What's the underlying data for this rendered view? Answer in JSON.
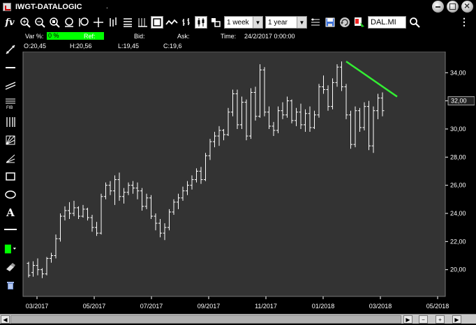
{
  "window": {
    "title": "IWGT-DATALOGIC",
    "dot": "."
  },
  "toolbar": {
    "logo": "fv",
    "period": "1 week",
    "range": "1 year",
    "symbol": "DAL.MI",
    "menu": "⋮",
    "icons": [
      "zoom-in-icon",
      "zoom-out-icon",
      "zoom-fit-icon",
      "zoom-x-icon",
      "zoom-y-icon",
      "crosshair-icon",
      "bars-icon",
      "list-icon",
      "grid-icon",
      "box-icon",
      "line-icon",
      "candle-icon",
      "compare-icon",
      "scale-icon",
      "save-icon",
      "refresh-icon",
      "color-icon",
      "search-icon"
    ]
  },
  "info": {
    "var_label": "Var %:",
    "var_value": "0 %",
    "ref_label": "Ref:",
    "bid_label": "Bid:",
    "ask_label": "Ask:",
    "time_label": "Time:",
    "time_value": "24/2/2017 0:00:00",
    "open": "O:20,45",
    "high": "H:20,56",
    "low": "L:19,45",
    "close": "C:19,6"
  },
  "left_tools": [
    "line-tool-icon",
    "hline-tool-icon",
    "channel-tool-icon",
    "fib-tool-icon",
    "cycle-tool-icon",
    "gann-tool-icon",
    "fan-tool-icon",
    "rect-tool-icon",
    "ellipse-tool-icon",
    "text-tool-icon",
    "divider-icon",
    "color-tool-icon",
    "eraser-icon",
    "trash-icon"
  ],
  "colors": {
    "plot_bg": "#333333",
    "price_bar": "#ffffff",
    "trendline": "#33ee33",
    "var_box": "#00ff00"
  },
  "chart_data": {
    "type": "ohlc",
    "x_tick_labels": [
      "03/2017",
      "05/2017",
      "07/2017",
      "09/2017",
      "11/2017",
      "01/2018",
      "03/2018",
      "05/2018"
    ],
    "y_ticks": [
      20,
      22,
      24,
      26,
      28,
      30,
      32,
      34
    ],
    "y_tick_labels": [
      "20,00",
      "22,00",
      "24,00",
      "26,00",
      "28,00",
      "30,00",
      "32,00",
      "34,00"
    ],
    "last_price_label": "32,00",
    "ylim": [
      18.1,
      35.5
    ],
    "bars": [
      [
        20.45,
        20.56,
        19.45,
        19.6
      ],
      [
        19.8,
        20.6,
        19.5,
        20.3
      ],
      [
        20.3,
        20.8,
        19.6,
        20.0
      ],
      [
        20.0,
        20.1,
        19.4,
        19.7
      ],
      [
        19.7,
        20.9,
        19.6,
        20.8
      ],
      [
        20.8,
        21.2,
        20.5,
        21.0
      ],
      [
        21.0,
        22.5,
        20.8,
        22.2
      ],
      [
        22.2,
        24.0,
        22.0,
        23.8
      ],
      [
        23.8,
        24.5,
        23.5,
        24.2
      ],
      [
        24.2,
        24.8,
        23.6,
        24.0
      ],
      [
        24.0,
        24.9,
        23.8,
        24.4
      ],
      [
        24.4,
        24.5,
        23.6,
        23.8
      ],
      [
        23.8,
        24.6,
        23.7,
        24.3
      ],
      [
        24.3,
        24.4,
        23.5,
        23.7
      ],
      [
        23.7,
        23.9,
        22.7,
        23.0
      ],
      [
        23.0,
        23.4,
        22.4,
        22.6
      ],
      [
        22.6,
        25.4,
        22.5,
        25.2
      ],
      [
        25.2,
        26.2,
        25.0,
        26.0
      ],
      [
        26.0,
        26.3,
        25.3,
        25.6
      ],
      [
        25.6,
        26.7,
        24.6,
        26.4
      ],
      [
        26.4,
        26.9,
        24.9,
        25.2
      ],
      [
        25.2,
        25.8,
        24.7,
        25.5
      ],
      [
        25.5,
        26.2,
        25.3,
        26.0
      ],
      [
        26.0,
        26.3,
        25.4,
        25.8
      ],
      [
        25.8,
        26.2,
        25.0,
        25.6
      ],
      [
        25.6,
        25.8,
        24.2,
        24.5
      ],
      [
        24.5,
        25.4,
        24.3,
        25.1
      ],
      [
        25.1,
        25.3,
        23.6,
        23.8
      ],
      [
        23.8,
        24.0,
        22.8,
        23.3
      ],
      [
        23.3,
        23.6,
        22.3,
        22.6
      ],
      [
        22.6,
        23.3,
        22.1,
        23.0
      ],
      [
        23.0,
        24.3,
        22.8,
        24.1
      ],
      [
        24.1,
        25.0,
        23.9,
        24.8
      ],
      [
        24.8,
        25.4,
        24.3,
        25.1
      ],
      [
        25.1,
        25.9,
        24.9,
        25.6
      ],
      [
        25.6,
        26.3,
        25.3,
        26.0
      ],
      [
        26.0,
        26.7,
        25.7,
        26.4
      ],
      [
        26.4,
        27.2,
        26.2,
        27.0
      ],
      [
        27.0,
        27.3,
        26.1,
        26.4
      ],
      [
        26.4,
        28.3,
        26.3,
        28.1
      ],
      [
        28.1,
        29.3,
        27.8,
        29.1
      ],
      [
        29.1,
        29.8,
        28.7,
        29.5
      ],
      [
        29.5,
        30.2,
        28.8,
        29.9
      ],
      [
        29.9,
        30.0,
        29.2,
        29.6
      ],
      [
        29.6,
        31.5,
        29.5,
        31.2
      ],
      [
        31.2,
        32.8,
        30.9,
        32.5
      ],
      [
        32.5,
        32.8,
        30.0,
        30.3
      ],
      [
        30.3,
        32.3,
        30.0,
        31.9
      ],
      [
        31.9,
        32.1,
        29.2,
        29.5
      ],
      [
        29.5,
        32.9,
        29.3,
        32.6
      ],
      [
        32.6,
        33.0,
        30.6,
        30.9
      ],
      [
        30.9,
        34.6,
        30.8,
        34.2
      ],
      [
        34.2,
        34.4,
        30.9,
        31.2
      ],
      [
        31.2,
        31.6,
        30.0,
        30.2
      ],
      [
        30.2,
        30.5,
        29.5,
        29.9
      ],
      [
        29.9,
        31.6,
        29.7,
        31.3
      ],
      [
        31.3,
        31.9,
        30.7,
        31.0
      ],
      [
        31.0,
        32.3,
        30.8,
        32.0
      ],
      [
        32.0,
        32.1,
        30.4,
        30.6
      ],
      [
        30.6,
        31.5,
        30.2,
        31.2
      ],
      [
        31.2,
        31.8,
        30.0,
        30.3
      ],
      [
        30.3,
        31.4,
        29.8,
        31.1
      ],
      [
        31.1,
        31.6,
        29.8,
        30.1
      ],
      [
        30.1,
        31.3,
        30.0,
        31.0
      ],
      [
        31.0,
        33.2,
        30.8,
        33.0
      ],
      [
        33.0,
        33.8,
        32.5,
        32.8
      ],
      [
        32.8,
        33.1,
        31.3,
        31.6
      ],
      [
        31.6,
        33.6,
        31.4,
        33.3
      ],
      [
        33.3,
        34.6,
        33.0,
        34.4
      ],
      [
        34.4,
        34.8,
        32.7,
        33.0
      ],
      [
        33.0,
        33.2,
        30.7,
        31.0
      ],
      [
        31.0,
        31.3,
        28.6,
        28.9
      ],
      [
        28.9,
        31.6,
        28.7,
        31.3
      ],
      [
        31.3,
        31.5,
        29.8,
        30.1
      ],
      [
        30.1,
        31.9,
        29.9,
        31.6
      ],
      [
        31.6,
        32.0,
        28.5,
        28.8
      ],
      [
        28.8,
        31.6,
        28.3,
        31.3
      ],
      [
        31.3,
        32.5,
        30.7,
        32.2
      ],
      [
        32.2,
        32.6,
        30.9,
        31.3
      ]
    ],
    "trendline": {
      "from_bar": 70,
      "from_price": 34.8,
      "to_bar": 80,
      "to_price": 32.3
    }
  }
}
